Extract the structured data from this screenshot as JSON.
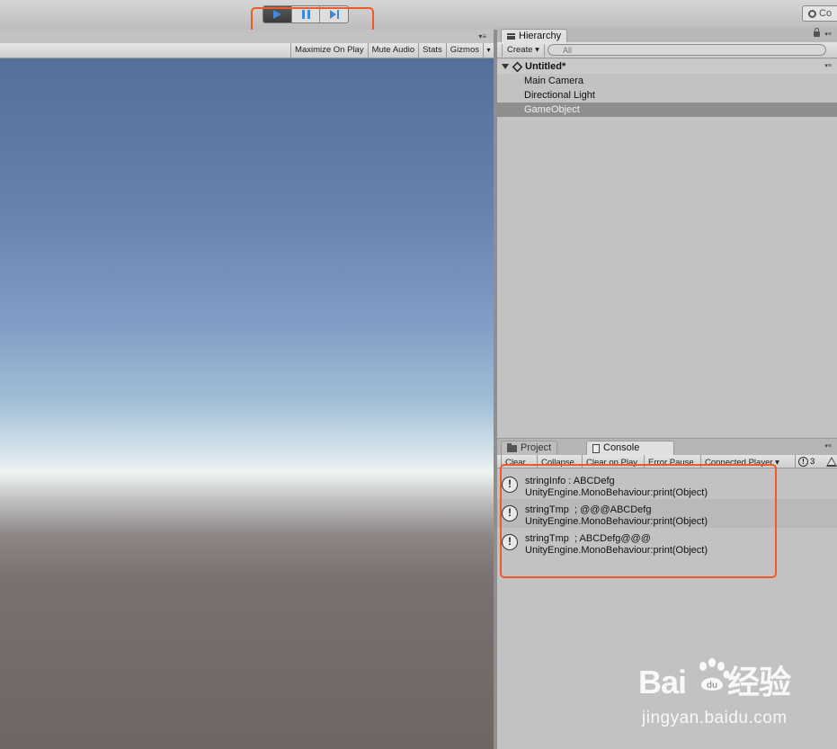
{
  "toolbar": {
    "play_controls": [
      "play",
      "pause",
      "step"
    ],
    "collab_label": "Co",
    "highlight_color": "#f05a28"
  },
  "game_view": {
    "options": [
      "Maximize On Play",
      "Mute Audio",
      "Stats",
      "Gizmos"
    ],
    "panel_menu": "▾≡"
  },
  "hierarchy": {
    "tab_label": "Hierarchy",
    "create_label": "Create",
    "search_placeholder": "All",
    "scene_name": "Untitled*",
    "items": [
      {
        "label": "Main Camera",
        "selected": false
      },
      {
        "label": "Directional Light",
        "selected": false
      },
      {
        "label": "GameObject",
        "selected": true
      }
    ]
  },
  "console": {
    "tabs": [
      "Project",
      "Console"
    ],
    "active_tab": "Console",
    "toolbar": [
      "Clear",
      "Collapse",
      "Clear on Play",
      "Error Pause",
      "Connected Player"
    ],
    "log_count": "3",
    "entries": [
      {
        "line1": "stringInfo : ABCDefg",
        "line2": "UnityEngine.MonoBehaviour:print(Object)"
      },
      {
        "line1": "stringTmp  ; @@@ABCDefg",
        "line2": "UnityEngine.MonoBehaviour:print(Object)"
      },
      {
        "line1": "stringTmp  ; ABCDefg@@@",
        "line2": "UnityEngine.MonoBehaviour:print(Object)"
      }
    ]
  },
  "watermark": {
    "logo": "Bai du 经验",
    "logo_left": "Bai",
    "logo_right": "经验",
    "url": "jingyan.baidu.com"
  }
}
